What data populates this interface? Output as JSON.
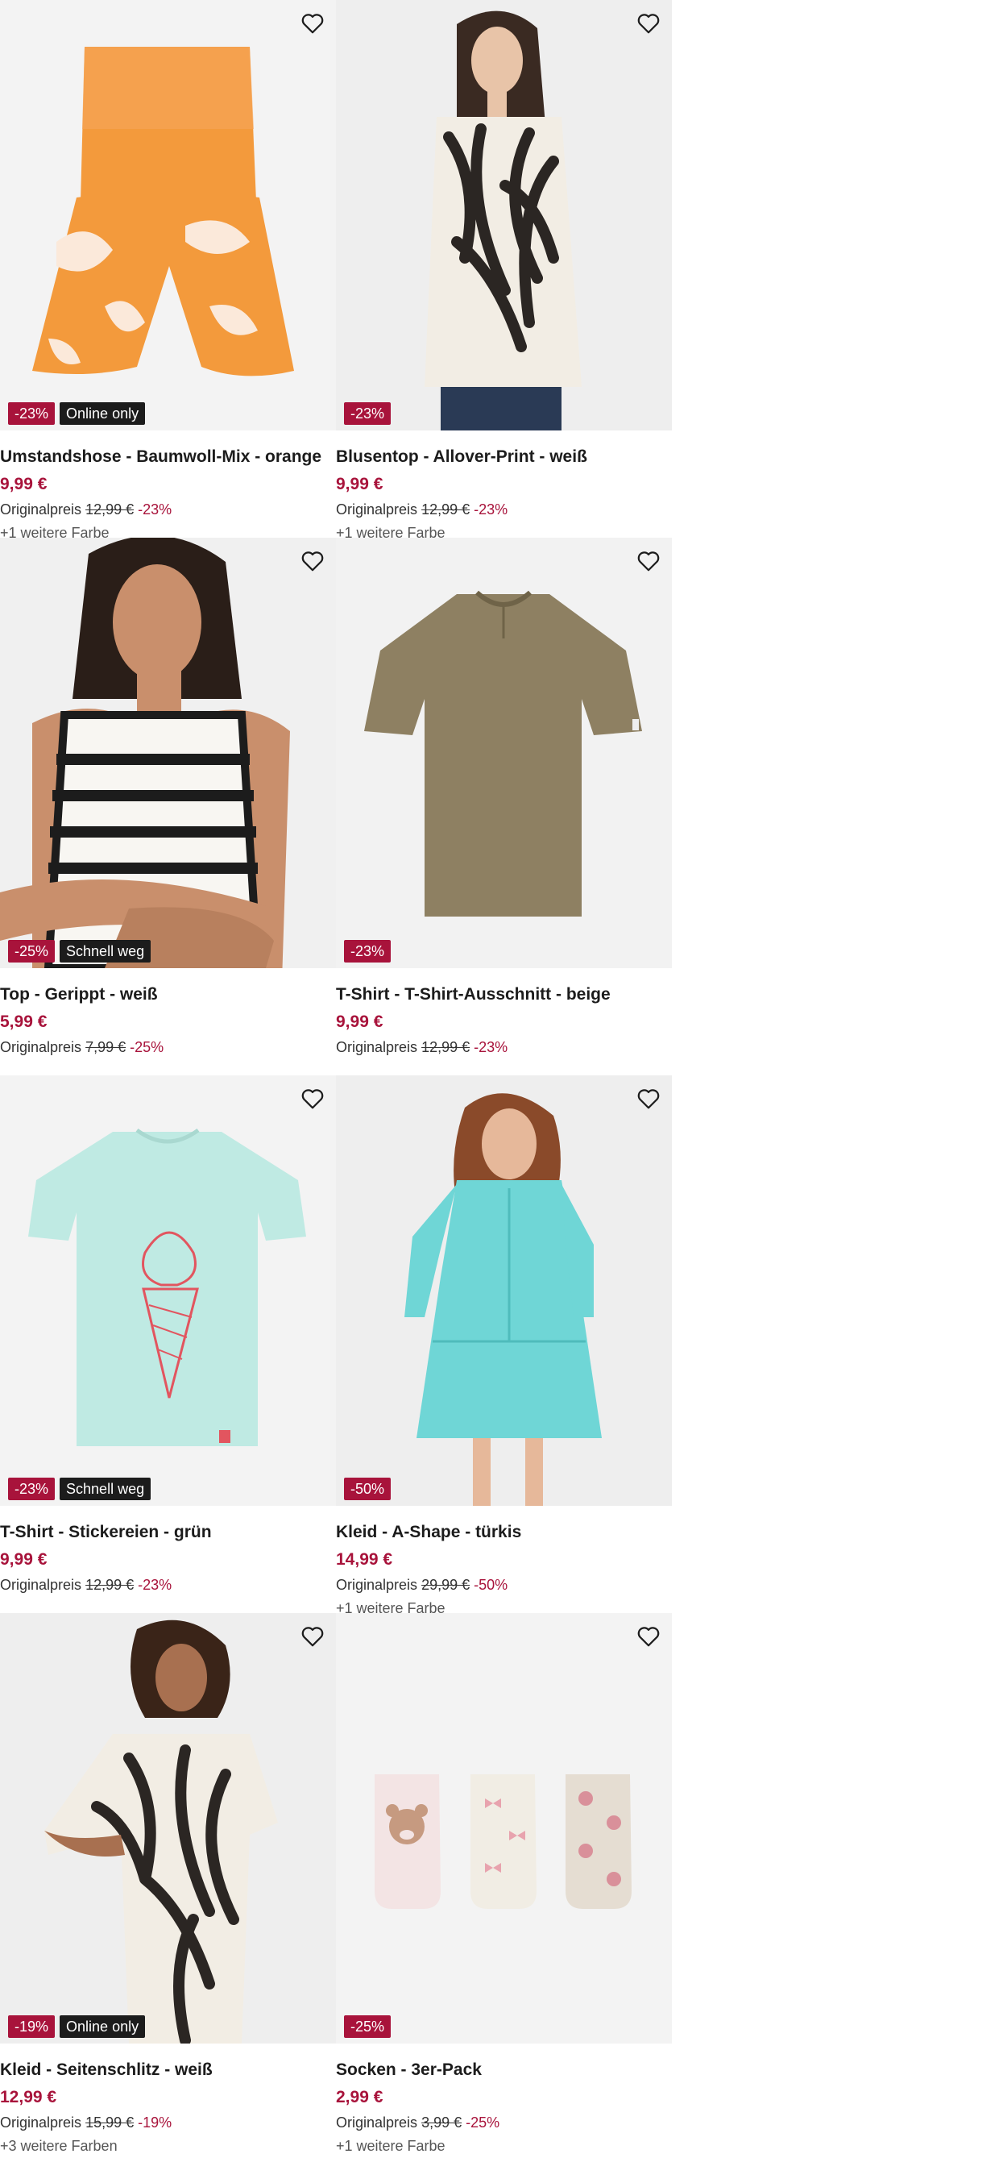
{
  "products": [
    {
      "name": "Umstandshose - Baumwoll-Mix - orange",
      "price": "9,99 €",
      "orig_label": "Originalpreis",
      "orig_price": "12,99 €",
      "discount": "-23%",
      "badges": [
        "-23%",
        "Online only"
      ],
      "colors_text": "+1 weitere Farbe",
      "image_bg": "#f3f3f3",
      "accent": "#f39a3c"
    },
    {
      "name": "Blusentop - Allover-Print - weiß",
      "price": "9,99 €",
      "orig_label": "Originalpreis",
      "orig_price": "12,99 €",
      "discount": "-23%",
      "badges": [
        "-23%"
      ],
      "colors_text": "+1 weitere Farbe",
      "image_bg": "#eeeeee",
      "accent": "#2b2623"
    },
    {
      "name": "Top - Gerippt - weiß",
      "price": "5,99 €",
      "orig_label": "Originalpreis",
      "orig_price": "7,99 €",
      "discount": "-25%",
      "badges": [
        "-25%",
        "Schnell weg"
      ],
      "colors_text": "",
      "image_bg": "#f0f0f0",
      "accent": "#1c1c1c"
    },
    {
      "name": "T-Shirt - T-Shirt-Ausschnitt - beige",
      "price": "9,99 €",
      "orig_label": "Originalpreis",
      "orig_price": "12,99 €",
      "discount": "-23%",
      "badges": [
        "-23%"
      ],
      "colors_text": "",
      "image_bg": "#f2f2f2",
      "accent": "#8e8062"
    },
    {
      "name": "T-Shirt - Stickereien - grün",
      "price": "9,99 €",
      "orig_label": "Originalpreis",
      "orig_price": "12,99 €",
      "discount": "-23%",
      "badges": [
        "-23%",
        "Schnell weg"
      ],
      "colors_text": "",
      "image_bg": "#f3f3f3",
      "accent": "#bfeae3"
    },
    {
      "name": "Kleid - A-Shape - türkis",
      "price": "14,99 €",
      "orig_label": "Originalpreis",
      "orig_price": "29,99 €",
      "discount": "-50%",
      "badges": [
        "-50%"
      ],
      "colors_text": "+1 weitere Farbe",
      "image_bg": "#eeeeee",
      "accent": "#6fd6d6"
    },
    {
      "name": "Kleid - Seitenschlitz - weiß",
      "price": "12,99 €",
      "orig_label": "Originalpreis",
      "orig_price": "15,99 €",
      "discount": "-19%",
      "badges": [
        "-19%",
        "Online only"
      ],
      "colors_text": "+3 weitere Farben",
      "image_bg": "#eeeeee",
      "accent": "#2b2623"
    },
    {
      "name": "Socken - 3er-Pack",
      "price": "2,99 €",
      "orig_label": "Originalpreis",
      "orig_price": "3,99 €",
      "discount": "-25%",
      "badges": [
        "-25%"
      ],
      "colors_text": "+1 weitere Farbe",
      "image_bg": "#f3f3f3",
      "accent": "#e8a3ae"
    }
  ],
  "icons": {
    "favorite": "heart-outline-icon"
  },
  "colors": {
    "sale": "#a8133b",
    "flag": "#1c1c1c",
    "text": "#1c1c1c"
  }
}
